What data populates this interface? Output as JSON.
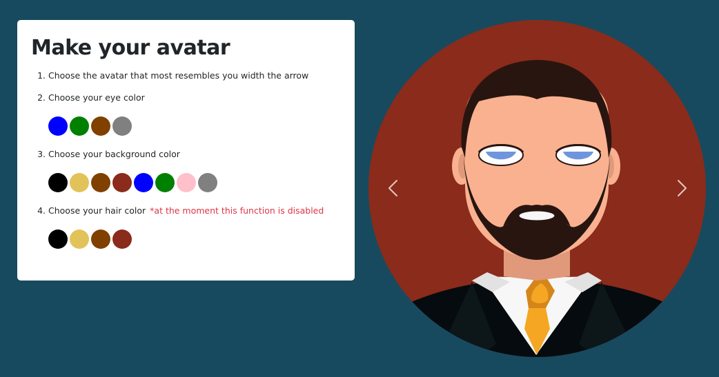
{
  "panel": {
    "title": "Make your avatar",
    "steps": [
      {
        "number": 1,
        "label": "Choose the avatar that most resembles you width the arrow"
      },
      {
        "number": 2,
        "label": "Choose your eye color",
        "colors": [
          "#0000ff",
          "#008000",
          "#804000",
          "#808080"
        ]
      },
      {
        "number": 3,
        "label": "Choose your background color",
        "colors": [
          "#000000",
          "#e2c35a",
          "#804000",
          "#8a2b1b",
          "#0000ff",
          "#008000",
          "#ffc0cb",
          "#808080"
        ]
      },
      {
        "number": 4,
        "label": "Choose your hair color",
        "note": "*at the moment this function is disabled",
        "colors": [
          "#000000",
          "#e2c35a",
          "#804000",
          "#8a2b1b"
        ]
      }
    ]
  },
  "avatar": {
    "background_color": "#8a2b1b",
    "eye_color": "#6f96dd",
    "hair_color": "#281510",
    "skin_color": "#f9b190",
    "prev_icon": "chevron-left-icon",
    "next_icon": "chevron-right-icon"
  },
  "colors": {
    "page_background": "#174a5e",
    "note": "#dc3545"
  }
}
